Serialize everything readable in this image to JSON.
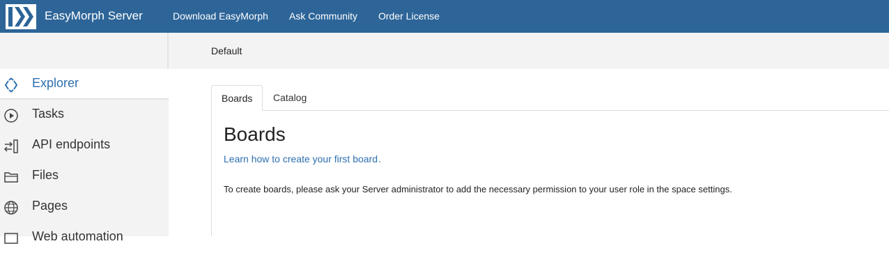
{
  "header": {
    "brand": "EasyMorph Server",
    "nav": [
      {
        "label": "Download EasyMorph"
      },
      {
        "label": "Ask Community"
      },
      {
        "label": "Order License"
      }
    ]
  },
  "breadcrumb": {
    "space": "Default"
  },
  "sidebar": {
    "items": [
      {
        "label": "Explorer",
        "icon": "explorer-icon",
        "active": true
      },
      {
        "label": "Tasks",
        "icon": "play-circle-icon"
      },
      {
        "label": "API endpoints",
        "icon": "api-endpoints-icon"
      },
      {
        "label": "Files",
        "icon": "folder-icon"
      },
      {
        "label": "Pages",
        "icon": "globe-icon"
      },
      {
        "label": "Web automation",
        "icon": "web-automation-icon"
      }
    ]
  },
  "main": {
    "tabs": [
      {
        "label": "Boards",
        "active": true
      },
      {
        "label": "Catalog"
      }
    ],
    "heading": "Boards",
    "learn_link": "Learn how to create your first board",
    "learn_suffix": ".",
    "info": "To create boards, please ask your Server administrator to add the necessary permission to your user role in the space settings."
  },
  "colors": {
    "header_bg": "#2d6598",
    "accent": "#2d6fb0",
    "sidebar_bg": "#f3f3f3"
  }
}
